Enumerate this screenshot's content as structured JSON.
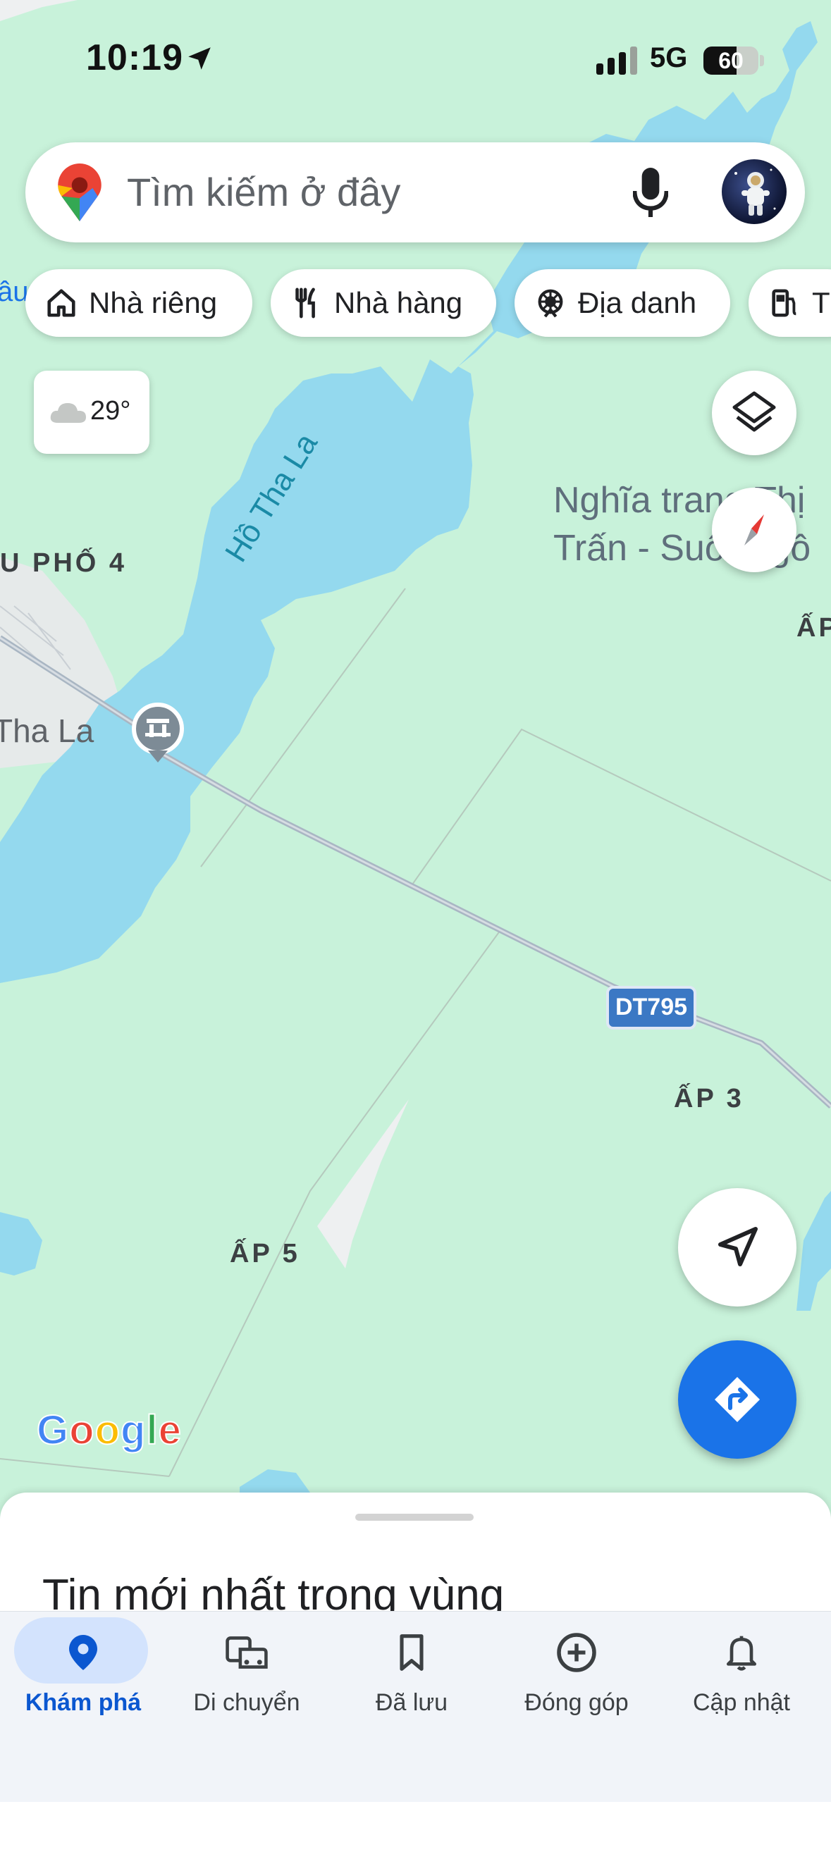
{
  "status_bar": {
    "time": "10:19",
    "network": "5G",
    "battery": "60",
    "battery_level": 0.6
  },
  "search": {
    "placeholder": "Tìm kiếm ở đây"
  },
  "chips": [
    {
      "label": "Nhà riêng",
      "icon": "home-icon"
    },
    {
      "label": "Nhà hàng",
      "icon": "restaurant-icon"
    },
    {
      "label": "Địa danh",
      "icon": "attraction-icon"
    },
    {
      "label": "T",
      "icon": "gas-station-icon"
    }
  ],
  "weather": {
    "temp": "29°",
    "icon": "cloud-icon"
  },
  "map": {
    "labels": {
      "lake": "Hồ Tha La",
      "cemetery_line1": "Nghĩa trang Thị",
      "cemetery_line2": "Trấn - Suối Ngô",
      "khu_pho": "U PHỐ 4",
      "tha_la": "Tha La",
      "ap3": "ẤP 3",
      "ap5": "ẤP 5",
      "ap_right": "ẤP",
      "left_edge": "âu"
    },
    "route_shield": "DT795",
    "colors": {
      "land": "#c8f2da",
      "water": "#94d9ee",
      "urban": "#eef0f1",
      "road": "#a9b6c3",
      "shield": "#3b78c4"
    }
  },
  "google_logo": {
    "letters": [
      {
        "ch": "G",
        "color": "#4285f4"
      },
      {
        "ch": "o",
        "color": "#ea4335"
      },
      {
        "ch": "o",
        "color": "#fbbc05"
      },
      {
        "ch": "g",
        "color": "#4285f4"
      },
      {
        "ch": "l",
        "color": "#34a853"
      },
      {
        "ch": "e",
        "color": "#ea4335"
      }
    ]
  },
  "sheet": {
    "title": "Tin mới nhất trong vùng"
  },
  "bottom_nav": [
    {
      "label": "Khám phá",
      "icon": "explore-pin-icon",
      "active": true
    },
    {
      "label": "Di chuyển",
      "icon": "commute-icon",
      "active": false
    },
    {
      "label": "Đã lưu",
      "icon": "bookmark-icon",
      "active": false
    },
    {
      "label": "Đóng góp",
      "icon": "add-circle-icon",
      "active": false
    },
    {
      "label": "Cập nhật",
      "icon": "bell-icon",
      "active": false
    }
  ]
}
